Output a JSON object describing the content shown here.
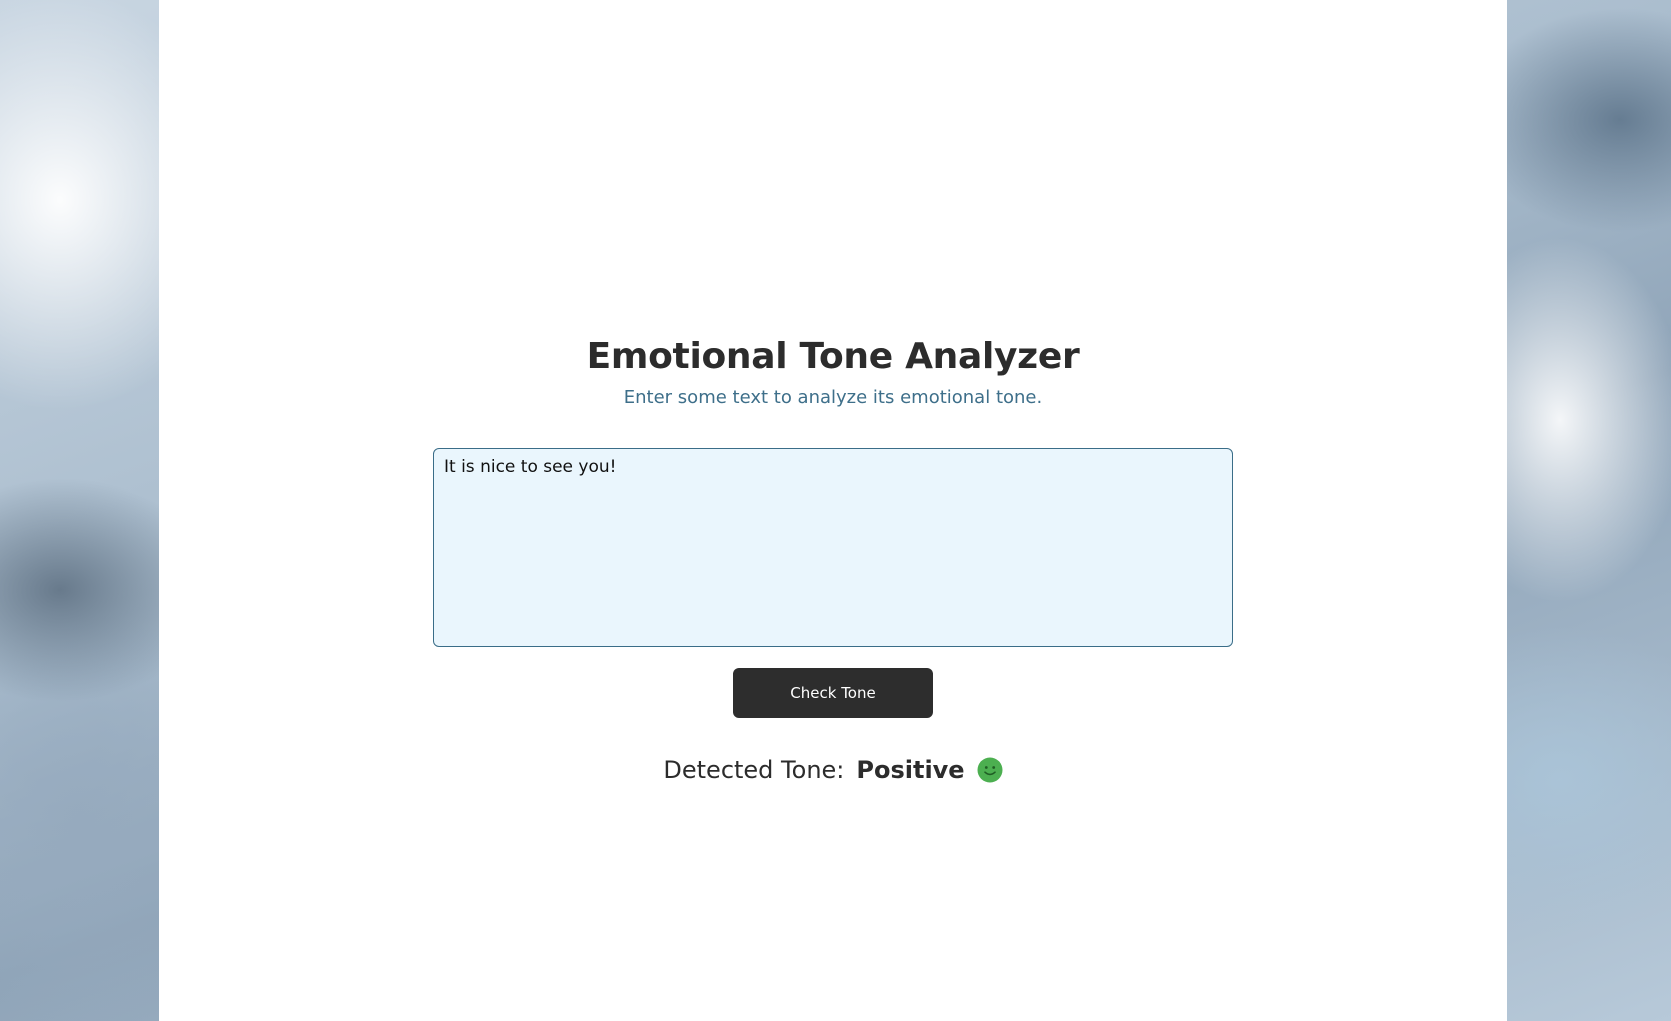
{
  "app": {
    "title": "Emotional Tone Analyzer",
    "subtitle": "Enter some text to analyze its emotional tone."
  },
  "input": {
    "value": "It is nice to see you!"
  },
  "actions": {
    "check_label": "Check Tone"
  },
  "result": {
    "label": "Detected Tone:",
    "value": "Positive",
    "icon": "smiley-face-icon",
    "icon_color": "#4caf50"
  },
  "colors": {
    "accent_button": "#2d2d2d",
    "subtitle": "#3e6f8a",
    "input_background": "#eaf6fd",
    "input_border": "#3a6d88"
  }
}
